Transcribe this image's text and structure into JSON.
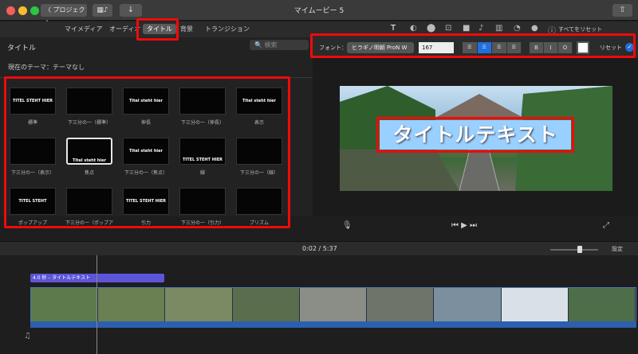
{
  "window": {
    "back_label": "〈 プロジェクト",
    "title": "マイムービー 5",
    "import_icon": "↓",
    "share_icon": "⇧",
    "library_icon": "▦♪"
  },
  "browser_tabs": [
    "マイメディア",
    "オーディオ",
    "タイトル",
    "背景",
    "トランジション"
  ],
  "inspector": {
    "tool_icons": [
      "T",
      "◐",
      "⬤",
      "⊡",
      "■",
      "♪",
      "▥",
      "◔",
      "●"
    ],
    "info_icon": "ⓘ",
    "reset_all": "すべてをリセット"
  },
  "left": {
    "section": "タイトル",
    "search_placeholder": "🔍 検索",
    "theme": "現在のテーマ：テーマなし",
    "tiles": [
      {
        "text": "TITEL STEHT HIER",
        "caption": "標準"
      },
      {
        "text": "",
        "caption": "下三分の一（標準）"
      },
      {
        "text": "Titel steht hier",
        "caption": "伸長"
      },
      {
        "text": "",
        "caption": "下三分の一（伸長）"
      },
      {
        "text": "Titel steht hier",
        "caption": "表示"
      },
      {
        "text": "",
        "caption": "下三分の一（表示）"
      },
      {
        "text": "Titel steht hier",
        "caption": "焦点"
      },
      {
        "text": "Titel steht hier",
        "caption": "下三分の一（焦点）"
      },
      {
        "text": "TITEL STEHT HIER",
        "caption": "線"
      },
      {
        "text": "",
        "caption": "下三分の一（線）"
      },
      {
        "text": "TITEL STEHT",
        "caption": "ポップアップ"
      },
      {
        "text": "",
        "caption": "下三分の一（ポップア"
      },
      {
        "text": "TITEL STEHT HIER",
        "caption": "引力"
      },
      {
        "text": "",
        "caption": "下三分の一（引力）"
      },
      {
        "text": "",
        "caption": "プリズム"
      }
    ]
  },
  "format": {
    "font_label": "フォント：",
    "font_value": "ヒラギノ明朝 ProN W",
    "size_value": "167",
    "align_icons": [
      "☰",
      "☰",
      "☰",
      "☰"
    ],
    "style_icons": [
      "B",
      "I",
      "O"
    ],
    "reset_label": "リセット",
    "check": "✓"
  },
  "viewer": {
    "title_text": "タイトルテキスト",
    "mic_icon": "🎙",
    "transport": "⏮  ▶  ⏭",
    "fullscreen_icon": "⤢"
  },
  "timeline": {
    "timecode": "0:02 / 5:37",
    "settings_label": "設定",
    "title_clip": "4.0 秒 – タイトルテキスト",
    "music_icon": "♫"
  },
  "colors": {
    "highlight": "#f00a0a",
    "accent": "#1f6fde",
    "title_clip": "#5d55d8"
  }
}
